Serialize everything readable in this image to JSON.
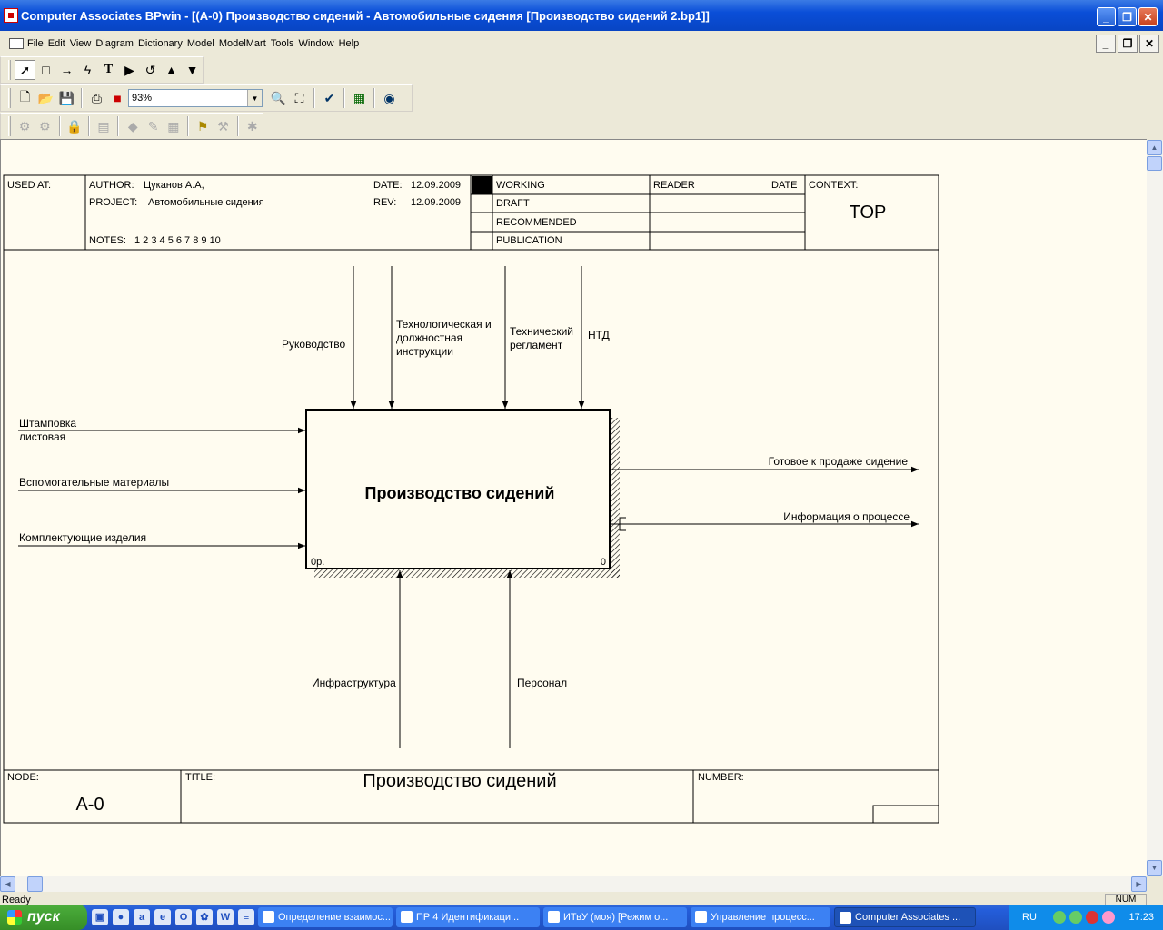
{
  "window": {
    "title": "Computer Associates BPwin - [(A-0)  Производство сидений - Автомобильные сидения  [Производство сидений 2.bp1]]"
  },
  "menu": [
    "File",
    "Edit",
    "View",
    "Diagram",
    "Dictionary",
    "Model",
    "ModelMart",
    "Tools",
    "Window",
    "Help"
  ],
  "toolbar": {
    "zoom_value": "93%"
  },
  "diagram": {
    "header": {
      "used_at_label": "USED AT:",
      "author_label": "AUTHOR:",
      "author": "Цуканов А.А,",
      "project_label": "PROJECT:",
      "project": "Автомобильные сидения",
      "date_label": "DATE:",
      "date": "12.09.2009",
      "rev_label": "REV:",
      "rev": "12.09.2009",
      "notes_label": "NOTES:",
      "notes": "1  2  3  4  5  6  7  8  9  10",
      "status": [
        "WORKING",
        "DRAFT",
        "RECOMMENDED",
        "PUBLICATION"
      ],
      "reader_label": "READER",
      "date_col_label": "DATE",
      "context_label": "CONTEXT:",
      "context_value": "TOP"
    },
    "activity": {
      "name": "Производство сидений",
      "cost": "0р.",
      "number": "0"
    },
    "controls": [
      {
        "label": "Руководство"
      },
      {
        "lines": [
          "Технологическая и",
          "должностная",
          "инструкции"
        ]
      },
      {
        "lines": [
          "Технический",
          "регламент"
        ]
      },
      {
        "label": "НТД"
      }
    ],
    "inputs": [
      {
        "lines": [
          "Штамповка",
          "листовая"
        ]
      },
      {
        "label": "Вспомогательные материалы"
      },
      {
        "label": "Комплектующие изделия"
      }
    ],
    "outputs": [
      {
        "label": "Готовое к продаже сидение"
      },
      {
        "label": "Информация о процессе"
      }
    ],
    "mechanisms": [
      {
        "label": "Инфраструктура"
      },
      {
        "label": "Персонал"
      }
    ],
    "footer": {
      "node_label": "NODE:",
      "node_value": "A-0",
      "title_label": "TITLE:",
      "title_value": "Производство сидений",
      "number_label": "NUMBER:"
    }
  },
  "status_bar": {
    "text": "Ready",
    "num": "NUM"
  },
  "taskbar": {
    "start": "пуск",
    "tasks": [
      {
        "label": "Определение взаимос..."
      },
      {
        "label": "ПР 4 Идентификаци..."
      },
      {
        "label": "ИТвУ (моя) [Режим о..."
      },
      {
        "label": "Управление процесс..."
      },
      {
        "label": "Computer Associates ..."
      }
    ],
    "lang": "RU",
    "clock": "17:23"
  }
}
